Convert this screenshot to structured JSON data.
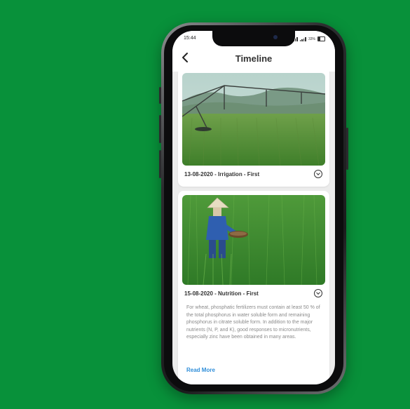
{
  "status_bar": {
    "time": "15:44",
    "battery": "33%"
  },
  "header": {
    "title": "Timeline",
    "back_icon": "back-arrow-icon"
  },
  "timeline": [
    {
      "title": "13-08-2020 - Irrigation - First",
      "image": "irrigation-photo",
      "expand_icon": "chevron-down-circle-icon"
    },
    {
      "title": "15-08-2020 - Nutrition - First",
      "image": "farmer-fertilizing-photo",
      "expand_icon": "chevron-down-circle-icon",
      "description": "For wheat, phosphatic fertilizers must contain at least 50 % of the total phosphorus in water soluble form and remaining phosphorus in citrate soluble form. In addition to the major nutrients (N, P, and K), good responses to micronutrients, especially zinc have been obtained in many areas.",
      "read_more": "Read More"
    }
  ],
  "colors": {
    "background": "#08913a",
    "accent_link": "#2f8ed9"
  }
}
